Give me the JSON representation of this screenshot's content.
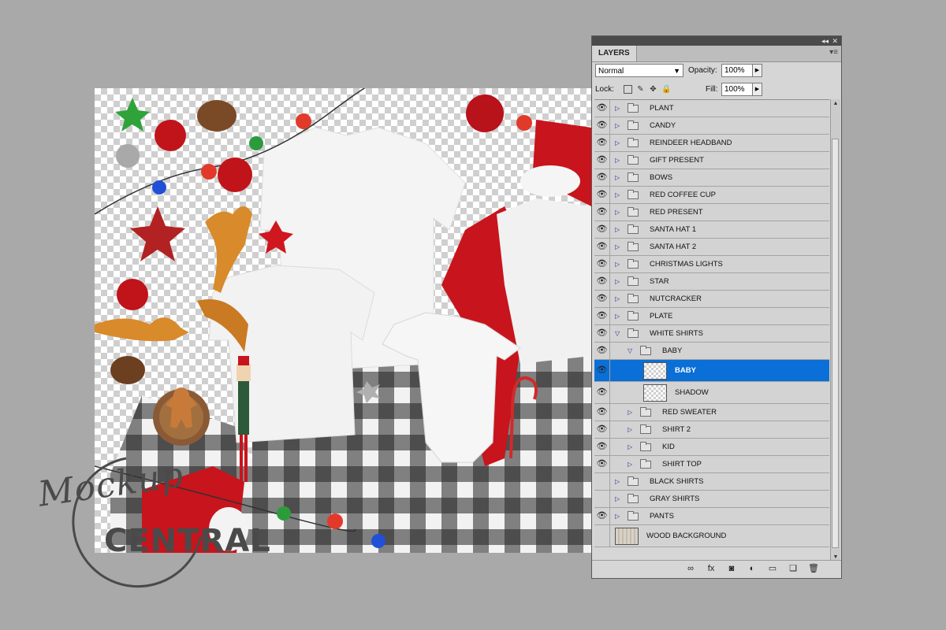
{
  "panel": {
    "tab_label": "LAYERS",
    "collapse_label": "◂◂",
    "close_label": "✕",
    "menu_label": "▾≡",
    "blend_mode": "Normal",
    "opacity_label": "Opacity:",
    "opacity_value": "100%",
    "lock_label": "Lock:",
    "fill_label": "Fill:",
    "fill_value": "100%"
  },
  "layers": [
    {
      "name": "PLANT",
      "visible": true,
      "indent": 0,
      "type": "group",
      "expanded": false
    },
    {
      "name": "CANDY",
      "visible": true,
      "indent": 0,
      "type": "group",
      "expanded": false
    },
    {
      "name": "REINDEER HEADBAND",
      "visible": true,
      "indent": 0,
      "type": "group",
      "expanded": false
    },
    {
      "name": "GIFT PRESENT",
      "visible": true,
      "indent": 0,
      "type": "group",
      "expanded": false
    },
    {
      "name": "BOWS",
      "visible": true,
      "indent": 0,
      "type": "group",
      "expanded": false
    },
    {
      "name": "RED COFFEE CUP",
      "visible": true,
      "indent": 0,
      "type": "group",
      "expanded": false
    },
    {
      "name": "RED PRESENT",
      "visible": true,
      "indent": 0,
      "type": "group",
      "expanded": false
    },
    {
      "name": "SANTA HAT 1",
      "visible": true,
      "indent": 0,
      "type": "group",
      "expanded": false
    },
    {
      "name": "SANTA HAT 2",
      "visible": true,
      "indent": 0,
      "type": "group",
      "expanded": false
    },
    {
      "name": "CHRISTMAS LIGHTS",
      "visible": true,
      "indent": 0,
      "type": "group",
      "expanded": false
    },
    {
      "name": "STAR",
      "visible": true,
      "indent": 0,
      "type": "group",
      "expanded": false
    },
    {
      "name": "NUTCRACKER",
      "visible": true,
      "indent": 0,
      "type": "group",
      "expanded": false
    },
    {
      "name": "PLATE",
      "visible": true,
      "indent": 0,
      "type": "group",
      "expanded": false
    },
    {
      "name": "WHITE SHIRTS",
      "visible": true,
      "indent": 0,
      "type": "group",
      "expanded": true
    },
    {
      "name": "BABY",
      "visible": true,
      "indent": 1,
      "type": "group",
      "expanded": true
    },
    {
      "name": "BABY",
      "visible": true,
      "indent": 2,
      "type": "layer",
      "selected": true
    },
    {
      "name": "SHADOW",
      "visible": true,
      "indent": 2,
      "type": "layer"
    },
    {
      "name": "RED SWEATER",
      "visible": true,
      "indent": 1,
      "type": "group",
      "expanded": false
    },
    {
      "name": "SHIRT 2",
      "visible": true,
      "indent": 1,
      "type": "group",
      "expanded": false
    },
    {
      "name": "KID",
      "visible": true,
      "indent": 1,
      "type": "group",
      "expanded": false
    },
    {
      "name": "SHIRT TOP",
      "visible": true,
      "indent": 1,
      "type": "group",
      "expanded": false
    },
    {
      "name": "BLACK SHIRTS",
      "visible": false,
      "indent": 0,
      "type": "group",
      "expanded": false
    },
    {
      "name": "GRAY SHIRTS",
      "visible": false,
      "indent": 0,
      "type": "group",
      "expanded": false
    },
    {
      "name": "PANTS",
      "visible": true,
      "indent": 0,
      "type": "group",
      "expanded": false
    },
    {
      "name": "WOOD BACKGROUND",
      "visible": false,
      "indent": 0,
      "type": "background"
    }
  ],
  "bottom_icons": [
    "link-icon",
    "fx-icon",
    "mask-icon",
    "adjustment-icon",
    "new-group-icon",
    "new-layer-icon",
    "trash-icon"
  ],
  "watermark": {
    "script": "Mockup",
    "block": "CENTRAL"
  },
  "colors": {
    "selection": "#0a6fd6",
    "panel_bg": "#d6d6d6",
    "page_bg": "#a9a9a9"
  }
}
